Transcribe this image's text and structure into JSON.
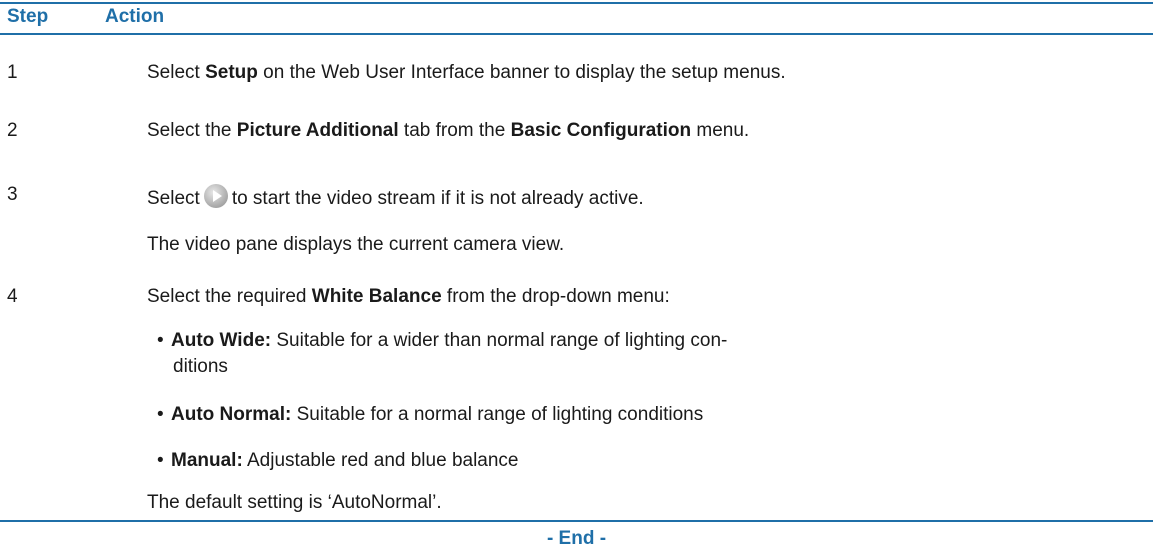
{
  "header": {
    "step": "Step",
    "action": "Action"
  },
  "steps": [
    {
      "num": "1",
      "pre": "Select ",
      "bold": "Setup",
      "post": " on the Web User Interface banner to display the setup menus."
    },
    {
      "num": "2",
      "pre": "Select the ",
      "bold": "Picture Additional",
      "mid": " tab from the ",
      "bold2": "Basic Configuration",
      "post": " menu."
    },
    {
      "num": "3",
      "pre": "Select",
      "post": "to start the video stream if it is not already active.",
      "note": "The video pane displays the current camera view."
    },
    {
      "num": "4",
      "pre": "Select the required ",
      "bold": "White Balance",
      "post": " from the drop-down menu:"
    }
  ],
  "bullets": [
    {
      "bold": "Auto Wide:",
      "text": " Suitable for a wider than normal range of lighting con-",
      "text2": "ditions"
    },
    {
      "bold": "Auto Normal:",
      "text": " Suitable for a normal range of lighting conditions"
    },
    {
      "bold": "Manual:",
      "text": " Adjustable red and blue balance"
    }
  ],
  "default_note": "The default setting is ‘AutoNormal’.",
  "end": "- End -",
  "icons": {
    "play": "play-icon"
  },
  "colors": {
    "accent": "#1f6fa8"
  }
}
